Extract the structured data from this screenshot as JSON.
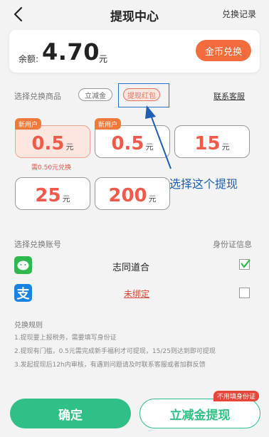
{
  "header": {
    "title": "提现中心",
    "right_link": "兑换记录"
  },
  "balance": {
    "label": "余额:",
    "value": "4.70",
    "unit": "元",
    "coin_exchange_button": "金币兑换"
  },
  "goods": {
    "label": "选择兑换商品",
    "tabs": [
      "立减金",
      "提现红包"
    ],
    "selected_tab": "提现红包",
    "service_link": "联系客服"
  },
  "options": [
    {
      "value": "0.5",
      "unit": "元",
      "badge": "新用户",
      "note": "需0.50元兑换"
    },
    {
      "value": "0.5",
      "unit": "元",
      "badge": "新用户"
    },
    {
      "value": "15",
      "unit": "元"
    },
    {
      "value": "25",
      "unit": "元"
    },
    {
      "value": "200",
      "unit": "元"
    }
  ],
  "annotation": "选择这个提现",
  "accounts": {
    "label": "选择兑换账号",
    "right_label": "身份证信息",
    "items": [
      {
        "name": "志同道合",
        "icon": "wechat-icon",
        "checked": true
      },
      {
        "name": "未绑定",
        "icon": "alipay-icon",
        "icon_char": "支",
        "checked": false
      }
    ]
  },
  "rules": {
    "title": "兑换规则",
    "items": [
      "1.提现要上报税务，需要填写身份证",
      "2.提现有门槛，0.5元需完成新手福利才可提现，15/25则达到即可提现",
      "3.发起提现后12h内审核，有遇到问题请及时联系客服或者加群反馈"
    ]
  },
  "footer": {
    "confirm_button": "确定",
    "discount_button": "立减金提现",
    "discount_tag": "不用填身份证"
  },
  "colors": {
    "accent_orange": "#f26c3d",
    "accent_green": "#30bf86",
    "annotation_blue": "#1f5fb0"
  }
}
